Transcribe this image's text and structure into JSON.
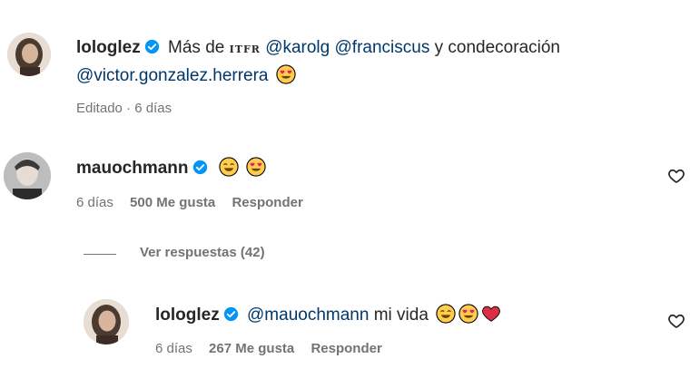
{
  "caption": {
    "username": "lologlez",
    "text_before": "Más de",
    "itfr": "ITFR",
    "mention1": "@karolg",
    "mention2": "@franciscus",
    "text_mid": "y condecoración",
    "mention3": "@victor.gonzalez.herrera",
    "emoji": "heart-eyes",
    "meta": "Editado · 6 días"
  },
  "comment1": {
    "username": "mauochmann",
    "emojis": [
      "grinning-smile",
      "heart-eyes"
    ],
    "time": "6 días",
    "likes": "500 Me gusta",
    "reply_label": "Responder"
  },
  "view_replies": "Ver respuestas (42)",
  "reply1": {
    "username": "lologlez",
    "mention": "@mauochmann",
    "text": "mi vida",
    "emojis": [
      "grinning-smile",
      "heart-eyes",
      "red-heart"
    ],
    "time": "6 días",
    "likes": "267 Me gusta",
    "reply_label": "Responder"
  },
  "colors": {
    "mention": "#00376b",
    "verified": "#0095f6",
    "meta": "#737373",
    "text": "#262626"
  }
}
